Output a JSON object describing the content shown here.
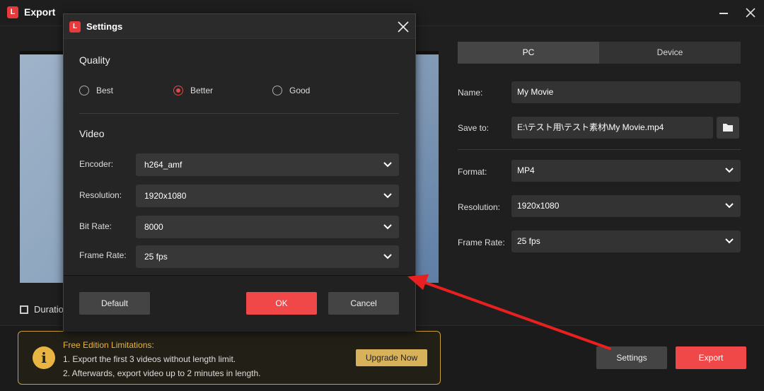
{
  "window": {
    "title": "Export"
  },
  "main": {
    "duration_label": "Duratio"
  },
  "right": {
    "tabs": [
      {
        "label": "PC"
      },
      {
        "label": "Device"
      }
    ],
    "name": {
      "label": "Name:",
      "value": "My Movie"
    },
    "save_to": {
      "label": "Save to:",
      "value": "E:\\テスト用\\テスト素材\\My Movie.mp4"
    },
    "format": {
      "label": "Format:",
      "value": "MP4"
    },
    "resolution": {
      "label": "Resolution:",
      "value": "1920x1080"
    },
    "frame_rate": {
      "label": "Frame Rate:",
      "value": "25 fps"
    }
  },
  "limitations": {
    "title": "Free Edition Limitations:",
    "line1": "1. Export the first 3 videos without length limit.",
    "line2": "2. Afterwards, export video up to 2 minutes in length.",
    "upgrade_label": "Upgrade Now"
  },
  "bottom": {
    "settings_label": "Settings",
    "export_label": "Export"
  },
  "dialog": {
    "title": "Settings",
    "quality": {
      "heading": "Quality",
      "options": [
        {
          "label": "Best"
        },
        {
          "label": "Better"
        },
        {
          "label": "Good"
        }
      ],
      "selected": "Better"
    },
    "video": {
      "heading": "Video",
      "encoder": {
        "label": "Encoder:",
        "value": "h264_amf"
      },
      "resolution": {
        "label": "Resolution:",
        "value": "1920x1080"
      },
      "bit_rate": {
        "label": "Bit Rate:",
        "value": "8000"
      },
      "frame_rate": {
        "label": "Frame Rate:",
        "value": "25 fps"
      }
    },
    "buttons": {
      "default_label": "Default",
      "ok_label": "OK",
      "cancel_label": "Cancel"
    }
  },
  "colors": {
    "accent_red": "#f04848",
    "gold": "#e8b542",
    "arrow": "#e82020"
  }
}
